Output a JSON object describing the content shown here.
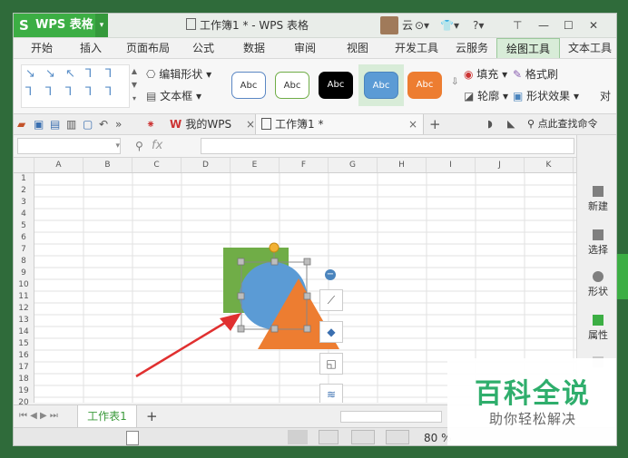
{
  "app": {
    "name": "WPS 表格",
    "logo_glyph": "S",
    "menu_arrow": "▾"
  },
  "window": {
    "title": "工作簿1 * - WPS 表格",
    "user": "云",
    "controls": [
      "⊙▾",
      "👕▾",
      "?▾",
      "⊤",
      "—",
      "☐",
      "✕"
    ]
  },
  "ribbon_tabs": [
    {
      "label": "开始"
    },
    {
      "label": "插入"
    },
    {
      "label": "页面布局"
    },
    {
      "label": "公式"
    },
    {
      "label": "数据"
    },
    {
      "label": "审阅"
    },
    {
      "label": "视图"
    },
    {
      "label": "开发工具"
    },
    {
      "label": "云服务"
    },
    {
      "label": "绘图工具"
    },
    {
      "label": "文本工具"
    }
  ],
  "active_tab": "绘图工具",
  "ribbon": {
    "shape_glyphs": [
      "↘",
      "↘",
      "↖",
      "⅂",
      "⅂",
      "⅂",
      "⅂",
      "⅂",
      "⅂",
      "⅂"
    ],
    "edit_shape": "编辑形状 ▾",
    "text_box": "文本框 ▾",
    "style_label": "Abc",
    "fill": "填充 ▾",
    "format_brush": "格式刷",
    "outline": "轮廓 ▾",
    "shape_effects": "形状效果 ▾",
    "right_cut": "对"
  },
  "doc_tabs": {
    "mywps": "我的WPS",
    "book": "工作簿1 *",
    "close": "×",
    "add": "+",
    "find": "点此查找命令"
  },
  "formula": {
    "fx": "fx",
    "zoom_glyph": "⚲",
    "namebox_arrow": "▾"
  },
  "columns": [
    "A",
    "B",
    "C",
    "D",
    "E",
    "F",
    "G",
    "H",
    "I",
    "J",
    "K"
  ],
  "rows": [
    "1",
    "2",
    "3",
    "4",
    "5",
    "6",
    "7",
    "8",
    "9",
    "10",
    "11",
    "12",
    "13",
    "14",
    "15",
    "16",
    "17",
    "18",
    "19",
    "20"
  ],
  "right_panel": [
    {
      "label": "新建"
    },
    {
      "label": "选择"
    },
    {
      "label": "形状"
    },
    {
      "label": "属性"
    }
  ],
  "sheet": {
    "name": "工作表1",
    "add": "+"
  },
  "status": {
    "zoom": "80 %"
  },
  "watermark": {
    "title": "百科全说",
    "subtitle": "助你轻松解决"
  },
  "colors": {
    "green": "#3cae44",
    "square": "#70ad47",
    "circle": "#5b9bd5",
    "triangle": "#ed7d31",
    "arrow": "#e03030"
  }
}
